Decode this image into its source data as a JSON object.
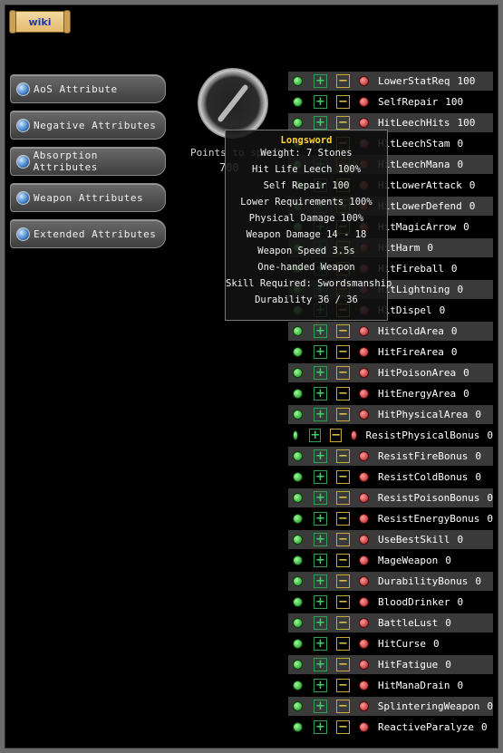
{
  "wiki_label": "wiki",
  "categories": [
    {
      "label": "AoS Attribute"
    },
    {
      "label": "Negative Attributes"
    },
    {
      "label": "Absorption Attributes"
    },
    {
      "label": "Weapon Attributes"
    },
    {
      "label": "Extended Attributes"
    }
  ],
  "points": {
    "label": "Points to spend",
    "value": "700"
  },
  "attributes": [
    {
      "name": "LowerStatReq",
      "value": "100"
    },
    {
      "name": "SelfRepair",
      "value": "100"
    },
    {
      "name": "HitLeechHits",
      "value": "100"
    },
    {
      "name": "HitLeechStam",
      "value": "0"
    },
    {
      "name": "HitLeechMana",
      "value": "0"
    },
    {
      "name": "HitLowerAttack",
      "value": "0"
    },
    {
      "name": "HitLowerDefend",
      "value": "0"
    },
    {
      "name": "HitMagicArrow",
      "value": "0"
    },
    {
      "name": "HitHarm",
      "value": "0"
    },
    {
      "name": "HitFireball",
      "value": "0"
    },
    {
      "name": "HitLightning",
      "value": "0"
    },
    {
      "name": "HitDispel",
      "value": "0"
    },
    {
      "name": "HitColdArea",
      "value": "0"
    },
    {
      "name": "HitFireArea",
      "value": "0"
    },
    {
      "name": "HitPoisonArea",
      "value": "0"
    },
    {
      "name": "HitEnergyArea",
      "value": "0"
    },
    {
      "name": "HitPhysicalArea",
      "value": "0"
    },
    {
      "name": "ResistPhysicalBonus",
      "value": "0"
    },
    {
      "name": "ResistFireBonus",
      "value": "0"
    },
    {
      "name": "ResistColdBonus",
      "value": "0"
    },
    {
      "name": "ResistPoisonBonus",
      "value": "0"
    },
    {
      "name": "ResistEnergyBonus",
      "value": "0"
    },
    {
      "name": "UseBestSkill",
      "value": "0"
    },
    {
      "name": "MageWeapon",
      "value": "0"
    },
    {
      "name": "DurabilityBonus",
      "value": "0"
    },
    {
      "name": "BloodDrinker",
      "value": "0"
    },
    {
      "name": "BattleLust",
      "value": "0"
    },
    {
      "name": "HitCurse",
      "value": "0"
    },
    {
      "name": "HitFatigue",
      "value": "0"
    },
    {
      "name": "HitManaDrain",
      "value": "0"
    },
    {
      "name": "SplinteringWeapon",
      "value": "0"
    },
    {
      "name": "ReactiveParalyze",
      "value": "0"
    }
  ],
  "tooltip": {
    "title": "Longsword",
    "lines": [
      "Weight: 7 Stones",
      "Hit Life Leech 100%",
      "Self Repair 100",
      "Lower Requirements 100%",
      "Physical Damage 100%",
      "Weapon Damage 14 - 18",
      "Weapon Speed 3.5s",
      "One-handed Weapon",
      "Skill Required: Swordsmanship",
      "Durability 36 / 36"
    ]
  },
  "colors": {
    "title": "#ffd23a",
    "plus": "#3bd16a",
    "minus": "#e6c24a",
    "wiki_text": "#1438c8"
  }
}
